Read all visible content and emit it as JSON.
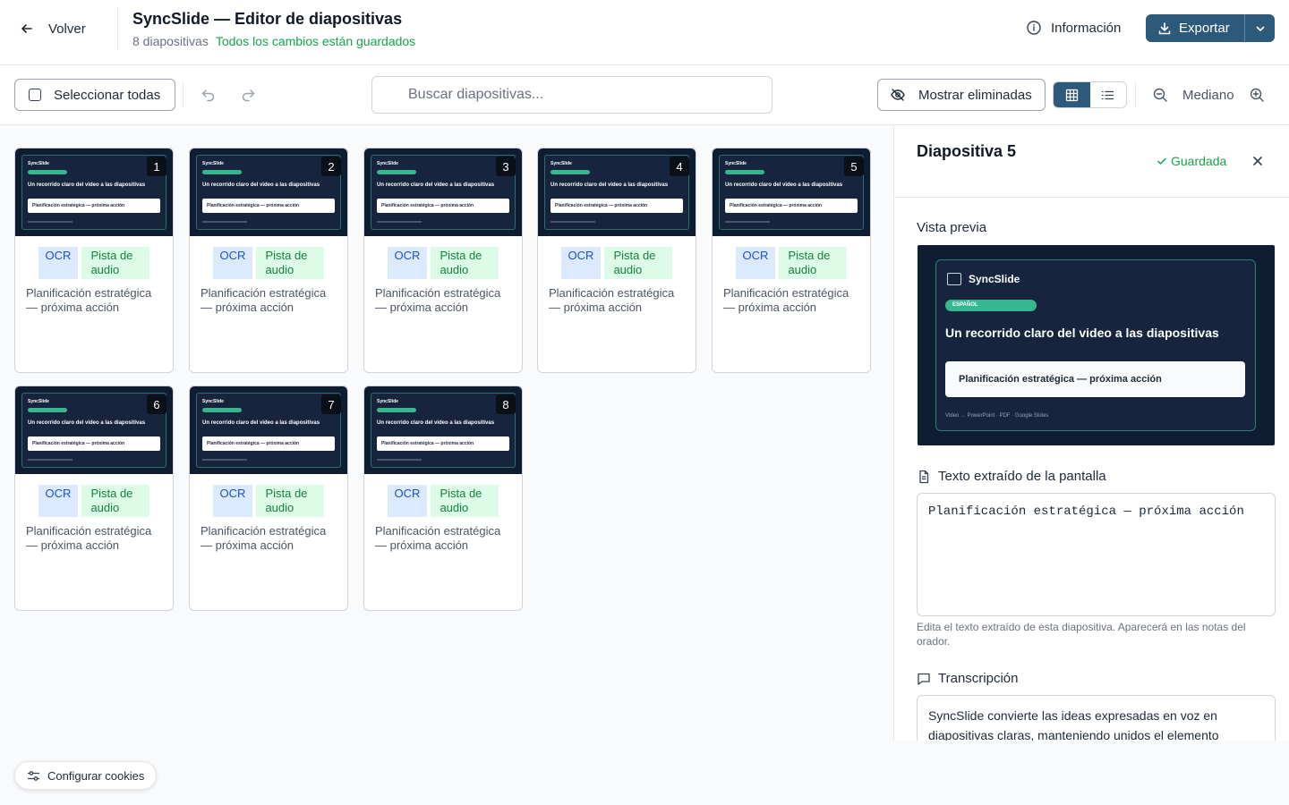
{
  "header": {
    "back_label": "Volver",
    "title": "SyncSlide — Editor de diapositivas",
    "slide_count": "8 diapositivas",
    "save_status": "Todos los cambios están guardados",
    "info_label": "Información",
    "export_label": "Exportar",
    "accent_color": "#2d5a7b"
  },
  "toolbar": {
    "select_all_label": "Seleccionar todas",
    "search_placeholder": "Buscar diapositivas...",
    "show_deleted_label": "Mostrar eliminadas",
    "view_mode": "grid",
    "zoom_label": "Mediano"
  },
  "slides": [
    {
      "number": "1",
      "ocr_badge": "OCR",
      "audio_badge": "Pista de audio",
      "text": "Planificación estratégica — próxima acción"
    },
    {
      "number": "2",
      "ocr_badge": "OCR",
      "audio_badge": "Pista de audio",
      "text": "Planificación estratégica — próxima acción"
    },
    {
      "number": "3",
      "ocr_badge": "OCR",
      "audio_badge": "Pista de audio",
      "text": "Planificación estratégica — próxima acción"
    },
    {
      "number": "4",
      "ocr_badge": "OCR",
      "audio_badge": "Pista de audio",
      "text": "Planificación estratégica — próxima acción"
    },
    {
      "number": "5",
      "ocr_badge": "OCR",
      "audio_badge": "Pista de audio",
      "text": "Planificación estratégica — próxima acción"
    },
    {
      "number": "6",
      "ocr_badge": "OCR",
      "audio_badge": "Pista de audio",
      "text": "Planificación estratégica — próxima acción"
    },
    {
      "number": "7",
      "ocr_badge": "OCR",
      "audio_badge": "Pista de audio",
      "text": "Planificación estratégica — próxima acción"
    },
    {
      "number": "8",
      "ocr_badge": "OCR",
      "audio_badge": "Pista de audio",
      "text": "Planificación estratégica — próxima acción"
    }
  ],
  "thumbnail": {
    "logo": "SyncSlide",
    "heading": "Un recorrido claro del video a las diapositivas",
    "box_text": "Planificación estratégica — próxima acción"
  },
  "panel": {
    "title": "Diapositiva 5",
    "saved_label": "Guardada",
    "preview_label": "Vista previa",
    "preview": {
      "logo": "SyncSlide",
      "pill": "ESPAÑOL",
      "heading": "Un recorrido claro del video a las diapositivas",
      "box_text": "Planificación estratégica — próxima acción",
      "footer": "Video → PowerPoint · PDF · Google Slides"
    },
    "ocr_label": "Texto extraído de la pantalla",
    "ocr_text": "Planificación estratégica — próxima acción",
    "ocr_help": "Edita el texto extraído de esta diapositiva. Aparecerá en las notas del orador.",
    "transcript_label": "Transcripción",
    "transcript_text": "SyncSlide convierte las ideas expresadas en voz en diapositivas claras, manteniendo unidos el elemento"
  },
  "cookies_label": "Configurar cookies"
}
